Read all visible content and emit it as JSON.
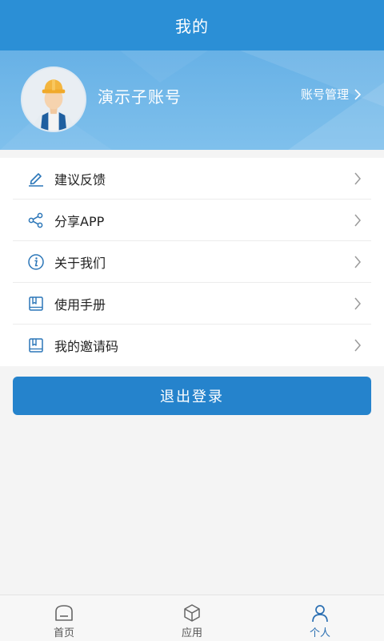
{
  "header": {
    "title": "我的"
  },
  "profile": {
    "account_name": "演示子账号",
    "manage_label": "账号管理"
  },
  "menu": {
    "items": [
      {
        "label": "建议反馈",
        "icon": "edit-icon"
      },
      {
        "label": "分享APP",
        "icon": "share-icon"
      },
      {
        "label": "关于我们",
        "icon": "info-icon"
      },
      {
        "label": "使用手册",
        "icon": "book-icon"
      },
      {
        "label": "我的邀请码",
        "icon": "invite-book-icon"
      }
    ]
  },
  "logout": {
    "label": "退出登录"
  },
  "tabbar": {
    "items": [
      {
        "label": "首页",
        "icon": "home-icon",
        "active": false
      },
      {
        "label": "应用",
        "icon": "cube-icon",
        "active": false
      },
      {
        "label": "个人",
        "icon": "person-icon",
        "active": true
      }
    ]
  },
  "colors": {
    "title_bar": "#2b8fd6",
    "profile_bg": "#72b8ea",
    "accent_button": "#2583cc",
    "icon_blue": "#2b76b8",
    "active_tab": "#2b6fb2"
  }
}
